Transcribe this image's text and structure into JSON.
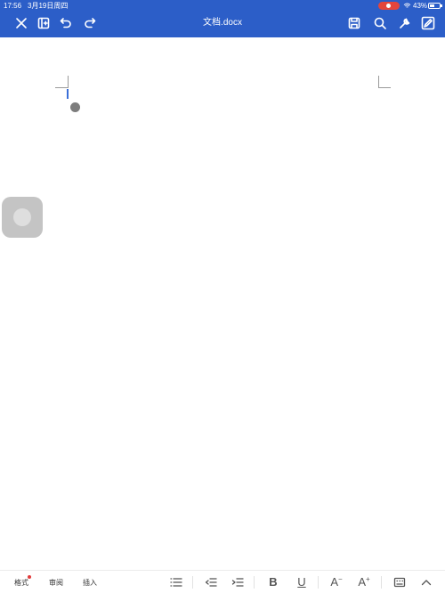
{
  "status_bar": {
    "time": "17:56",
    "date": "3月19日周四",
    "battery": "43%"
  },
  "header": {
    "title": "文档.docx",
    "left_icons": [
      "close-icon",
      "multi-window-icon",
      "undo-icon",
      "redo-icon"
    ],
    "right_icons": [
      "save-icon",
      "search-icon",
      "tools-icon",
      "pen-icon"
    ]
  },
  "bottom_bar": {
    "tabs": [
      {
        "label": "格式",
        "badge": true
      },
      {
        "label": "审阅",
        "badge": false
      },
      {
        "label": "插入",
        "badge": false
      }
    ],
    "tools": {
      "bold": "B",
      "underline": "U",
      "font_decrease": "A",
      "font_increase": "A"
    }
  },
  "colors": {
    "accent": "#2c5ec8",
    "badge": "#e23b3b",
    "cursor": "#3a6fd8"
  }
}
